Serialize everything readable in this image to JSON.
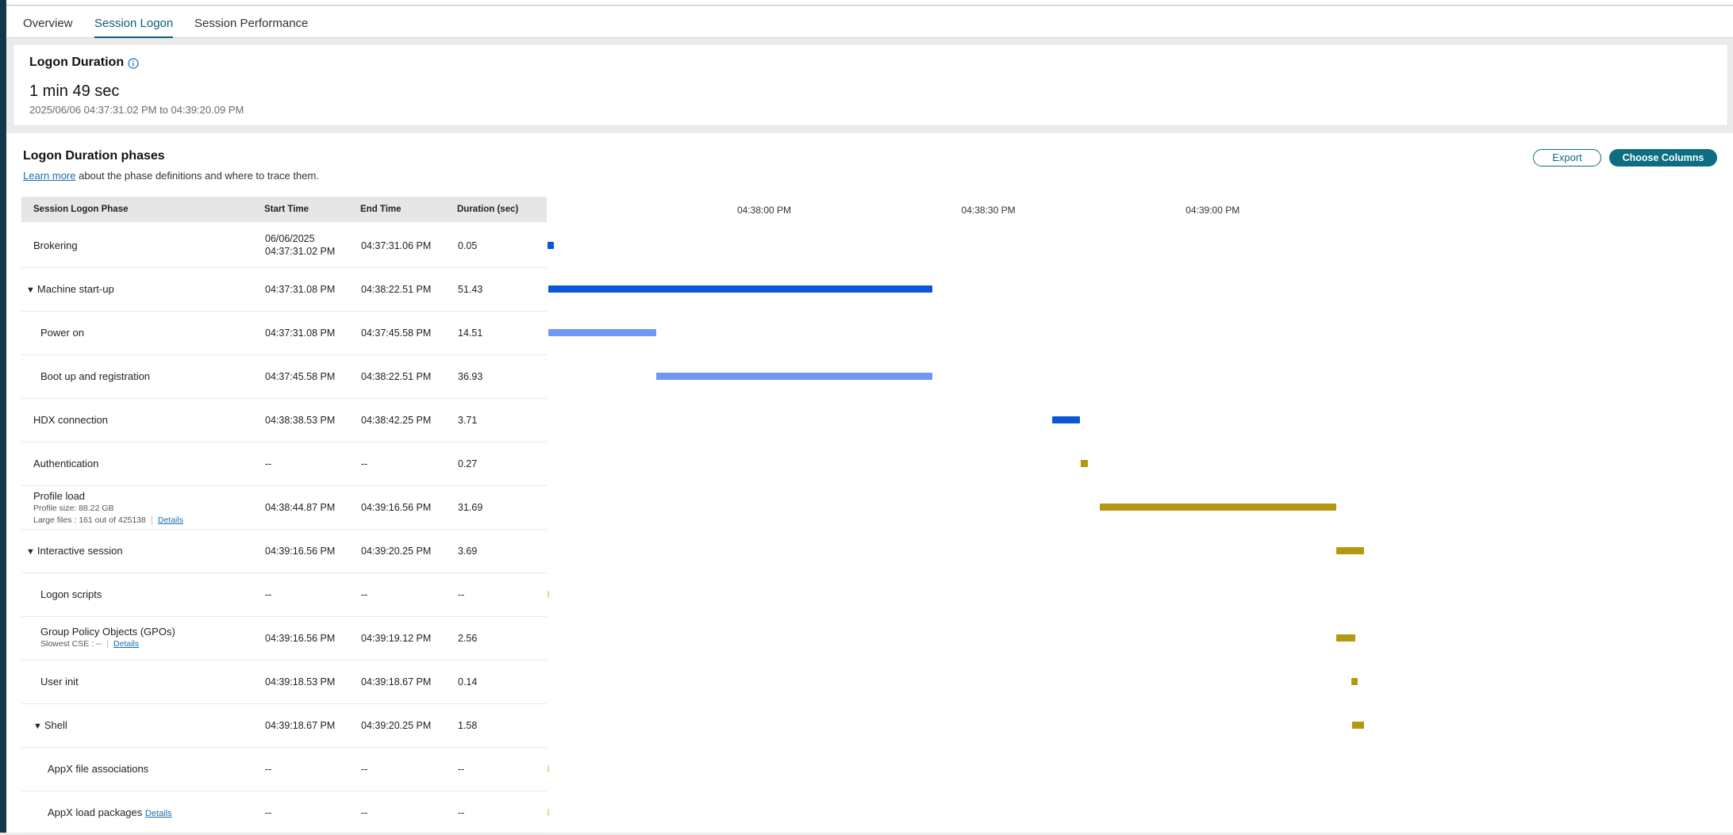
{
  "tabs": [
    {
      "label": "Overview",
      "active": false
    },
    {
      "label": "Session Logon",
      "active": true
    },
    {
      "label": "Session Performance",
      "active": false
    }
  ],
  "summary": {
    "title": "Logon Duration",
    "value": "1 min 49 sec",
    "range": "2025/06/06 04:37:31.02 PM to 04:39:20.09 PM"
  },
  "phases": {
    "title": "Logon Duration phases",
    "learn_more": "Learn more",
    "subtitle_rest": " about the phase definitions and where to trace them.",
    "export_label": "Export",
    "choose_columns_label": "Choose Columns",
    "columns": {
      "phase": "Session Logon Phase",
      "start": "Start Time",
      "end": "End Time",
      "duration": "Duration (sec)"
    },
    "timeline_ticks": [
      {
        "label": "04:38:00 PM",
        "seconds": 28.98
      },
      {
        "label": "04:38:30 PM",
        "seconds": 58.98
      },
      {
        "label": "04:39:00 PM",
        "seconds": 88.98
      }
    ],
    "rows": [
      {
        "name": "Brokering",
        "indent": 0,
        "expanded": null,
        "start": "06/06/2025",
        "start2": "04:37:31.02 PM",
        "end": "04:37:31.06 PM",
        "duration": "0.05",
        "bar": {
          "start": 0.0,
          "length": 0.8,
          "color": "dark"
        }
      },
      {
        "name": "Machine start-up",
        "indent": 0,
        "expanded": true,
        "start": "04:37:31.08 PM",
        "end": "04:38:22.51 PM",
        "duration": "51.43",
        "bar": {
          "start": 0.06,
          "length": 51.43,
          "color": "dark"
        }
      },
      {
        "name": "Power on",
        "indent": 1,
        "expanded": null,
        "start": "04:37:31.08 PM",
        "end": "04:37:45.58 PM",
        "duration": "14.51",
        "bar": {
          "start": 0.06,
          "length": 14.51,
          "color": "light"
        }
      },
      {
        "name": "Boot up and registration",
        "indent": 1,
        "expanded": null,
        "start": "04:37:45.58 PM",
        "end": "04:38:22.51 PM",
        "duration": "36.93",
        "bar": {
          "start": 14.56,
          "length": 36.93,
          "color": "light"
        }
      },
      {
        "name": "HDX connection",
        "indent": 0,
        "expanded": null,
        "start": "04:38:38.53 PM",
        "end": "04:38:42.25 PM",
        "duration": "3.71",
        "bar": {
          "start": 67.51,
          "length": 3.71,
          "color": "dark"
        }
      },
      {
        "name": "Authentication",
        "indent": 0,
        "expanded": null,
        "start": "--",
        "end": "--",
        "duration": "0.27",
        "bar": {
          "start": 71.3,
          "length": 1.0,
          "color": "gold"
        }
      },
      {
        "name": "Profile load",
        "indent": 0,
        "expanded": null,
        "start": "04:38:44.87 PM",
        "end": "04:39:16.56 PM",
        "duration": "31.69",
        "meta1": "Profile size: 88.22 GB",
        "meta2": "Large files : 161 out of 425138",
        "details": "Details",
        "bar": {
          "start": 73.85,
          "length": 31.69,
          "color": "gold"
        }
      },
      {
        "name": "Interactive session",
        "indent": 0,
        "expanded": true,
        "start": "04:39:16.56 PM",
        "end": "04:39:20.25 PM",
        "duration": "3.69",
        "bar": {
          "start": 105.54,
          "length": 3.69,
          "color": "gold"
        }
      },
      {
        "name": "Logon scripts",
        "indent": 1,
        "expanded": null,
        "start": "--",
        "end": "--",
        "duration": "--",
        "bar": null
      },
      {
        "name": "Group Policy Objects (GPOs)",
        "indent": 1,
        "expanded": null,
        "start": "04:39:16.56 PM",
        "end": "04:39:19.12 PM",
        "duration": "2.56",
        "meta1": "Slowest CSE : --",
        "details": "Details",
        "bar": {
          "start": 105.54,
          "length": 2.56,
          "color": "gold"
        }
      },
      {
        "name": "User init",
        "indent": 1,
        "expanded": null,
        "start": "04:39:18.53 PM",
        "end": "04:39:18.67 PM",
        "duration": "0.14",
        "bar": {
          "start": 107.51,
          "length": 0.9,
          "color": "gold"
        }
      },
      {
        "name": "Shell",
        "indent": 1,
        "expanded": true,
        "start": "04:39:18.67 PM",
        "end": "04:39:20.25 PM",
        "duration": "1.58",
        "bar": {
          "start": 107.65,
          "length": 1.58,
          "color": "gold"
        }
      },
      {
        "name": "AppX file associations",
        "indent": 2,
        "expanded": null,
        "start": "--",
        "end": "--",
        "duration": "--",
        "bar": null
      },
      {
        "name": "AppX load packages",
        "indent": 2,
        "expanded": null,
        "start": "--",
        "end": "--",
        "duration": "--",
        "inline_details": "Details",
        "bar": null
      }
    ]
  },
  "colors": {
    "accent": "#0c6e80",
    "bar_dark": "#0b57d8",
    "bar_light": "#6f97f5",
    "bar_gold": "#b4990f"
  }
}
